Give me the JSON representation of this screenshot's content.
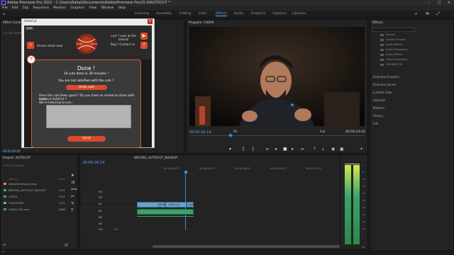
{
  "title": "Adobe Premiere Pro 2021 - C:\\Users\\Rahat\\Documents\\Adobe\\Premiere Pro\\15.0\\AUTOCUT *",
  "menu": [
    "File",
    "Edit",
    "Clip",
    "Sequence",
    "Markers",
    "Graphics",
    "View",
    "Window",
    "Help"
  ],
  "workspaces": [
    "Learning",
    "Assembly",
    "Editing",
    "Color",
    "Effects",
    "Audio",
    "Graphics",
    "Libraries"
  ],
  "workspaces_extra": [
    "Captions"
  ],
  "effect_controls": {
    "tab": "Effect Controls",
    "empty": "(no clip selected)",
    "timecode": "00:00:00:00"
  },
  "autocut": {
    "window_title": "AutoCut",
    "badge": "CSS",
    "access_client_area": "Access client area",
    "lost_text": "Lost ? Look at the tutorial",
    "bug_text": "Bug ? Contact us",
    "done_title": "Done !",
    "cuts_line": "14 cuts done in 30 minutes !",
    "not_satisfied": "You are not satisfied with the cuts ?",
    "undo_label": "Undo cuts",
    "review_line1": "Have the cuts been good ? Do you have an review to share with us to",
    "review_line2": "improve AutoCut ?",
    "review_line3": "We're listening to you :",
    "send_label": "Send"
  },
  "program": {
    "tab": "Program: CS004",
    "timecode_left": "00:00:20:14",
    "timecode_right": "00:00:24:00",
    "fit": "Full",
    "zoom": "Fit"
  },
  "effects": {
    "tab": "Effects",
    "folders": [
      "Presets",
      "Lumetri Presets",
      "Audio Effects",
      "Audio Transitions",
      "Video Effects",
      "Video Transitions",
      "HISNIMUTTEL"
    ],
    "sections": [
      "Essential Graphics",
      "Essential Sound",
      "Lumetri Color",
      "Libraries",
      "Markers",
      "History",
      "Info"
    ]
  },
  "project": {
    "tab": "Project: AUTOCUT",
    "file": "AUTOCUT.prproj",
    "col_name": "Name",
    "col_rate": "Fram",
    "items": [
      {
        "name": "AdjustmentLayer.asp",
        "rate": "",
        "color": "#d68a3a"
      },
      {
        "name": "BEFORE_AUTOCUT_BACKUP",
        "rate": "23.9",
        "color": "#3aa36b"
      },
      {
        "name": "CS004",
        "rate": "23.9",
        "color": "#3aa36b"
      },
      {
        "name": "CS004.MP4",
        "rate": "23.9",
        "color": "#6ba3c9"
      },
      {
        "name": "AUDIO 001.wav",
        "rate": "4800",
        "color": "#3aa36b"
      }
    ]
  },
  "timeline": {
    "tab": "BEFORE_AUTOCUT_BACKUP",
    "timecode": "00:00:20:14",
    "ruler": [
      "00:00:14:23",
      "00:00:29:23",
      "00:00:44:22",
      "00:00:59:22",
      "00:01:14:22"
    ],
    "video_tracks": [
      "V3",
      "V2",
      "V1"
    ],
    "audio_tracks": [
      "A1",
      "A2",
      "A3"
    ],
    "mix": "Mix",
    "mix_value": "0.0",
    "clip_labels": [
      "CS004 [V]",
      "CS004 [V]",
      "CS004 [V]"
    ]
  },
  "meter_scale": [
    "0",
    "-6",
    "-12",
    "-18",
    "-24",
    "-30",
    "-36",
    "-42",
    "-48",
    "-54",
    "dB"
  ],
  "colors": {
    "accent": "#2d8ceb",
    "autocut_red": "#d84a2b",
    "video_clip": "#6ba3c9",
    "audio_clip": "#3aa36b"
  }
}
